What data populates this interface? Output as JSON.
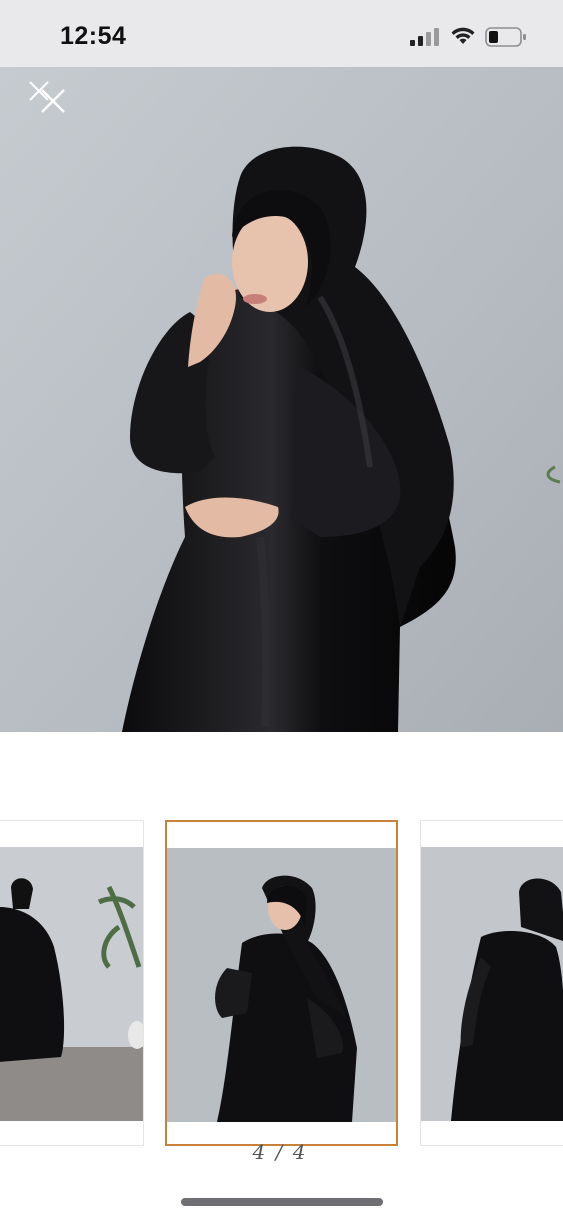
{
  "status_bar": {
    "time": "12:54",
    "signal_icon": "cellular-signal-icon",
    "wifi_icon": "wifi-icon",
    "battery_icon": "battery-icon"
  },
  "viewer": {
    "close_icon": "close-icon",
    "page_indicator": "4 / 4",
    "selected_thumbnail": 2,
    "thumbnail_count": 3
  },
  "colors": {
    "status_bar_bg": "#e9e9eb",
    "photo_wall": "#b7bcc1",
    "garment": "#0c0c0e",
    "selected_border": "#c8813a",
    "home_indicator": "#6e6e73"
  }
}
